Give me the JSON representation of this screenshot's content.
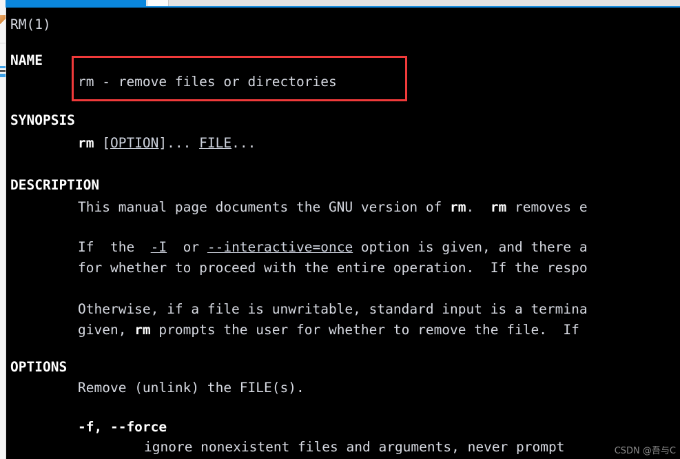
{
  "window": {
    "top_strip": {
      "active_tab_color": "#0b87dd",
      "inactive_tab_color": "#e2e2e2"
    },
    "terminal": {
      "background": "#000000",
      "foreground": "#d7dae2"
    }
  },
  "manpage": {
    "header_left": "RM(1)",
    "sections": [
      {
        "name": "NAME",
        "heading": "NAME",
        "lines": [
          {
            "indent": 113,
            "text": "rm - remove files or directories"
          }
        ]
      },
      {
        "name": "SYNOPSIS",
        "heading": "SYNOPSIS",
        "lines": [
          {
            "indent": 113,
            "text": "rm [OPTION]... FILE..."
          }
        ]
      },
      {
        "name": "DESCRIPTION",
        "heading": "DESCRIPTION",
        "lines": [
          {
            "indent": 113,
            "text": "This manual page documents the GNU version of rm.  rm removes e"
          },
          {
            "indent": 113,
            "text": "If  the  -I  or --interactive=once option is given, and there a"
          },
          {
            "indent": 113,
            "text": "for whether to proceed with the entire operation.  If the respo"
          },
          {
            "indent": 113,
            "text": "Otherwise, if a file is unwritable, standard input is a termina"
          },
          {
            "indent": 113,
            "text": "given, rm prompts the user for whether to remove the file.  If"
          }
        ]
      },
      {
        "name": "OPTIONS",
        "heading": "OPTIONS",
        "lines": [
          {
            "indent": 113,
            "text": "Remove (unlink) the FILE(s)."
          },
          {
            "indent": 113,
            "text": "-f, --force"
          },
          {
            "indent": 210,
            "text": "ignore nonexistent files and arguments, never prompt"
          }
        ]
      }
    ],
    "bold_tokens": [
      "rm",
      "-f",
      "--force"
    ],
    "underlined_tokens": [
      "OPTION",
      "FILE",
      "-I",
      "--interactive=once"
    ]
  },
  "annotation": {
    "type": "rectangle-highlight",
    "color": "#f03a3a",
    "target_text": "rm - remove files or directories"
  },
  "watermark": {
    "text": "CSDN @吾与C"
  }
}
